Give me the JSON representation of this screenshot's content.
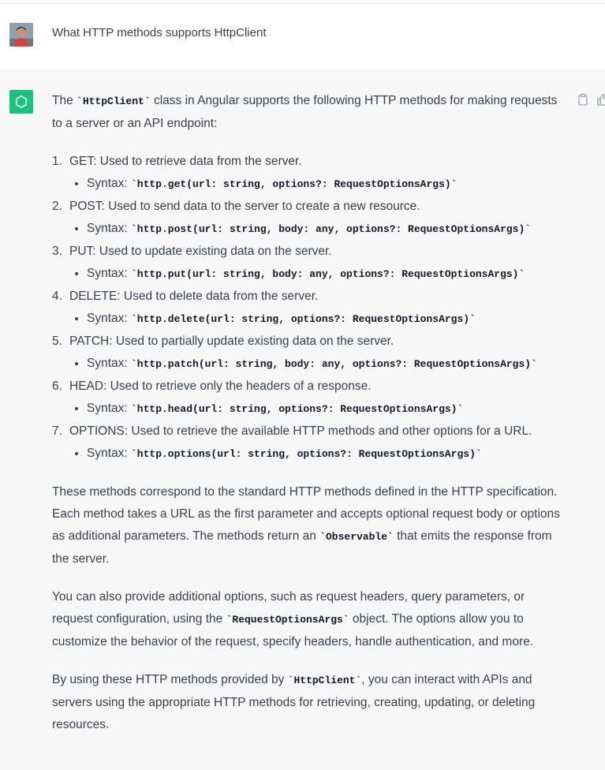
{
  "user": {
    "question": "What HTTP methods supports HttpClient"
  },
  "assistant": {
    "intro": {
      "before": "The ",
      "code": "`HttpClient`",
      "after": " class in Angular supports the following HTTP methods for making requests to a server or an API endpoint:"
    },
    "methods": [
      {
        "number": "1.",
        "text": "GET: Used to retrieve data from the server.",
        "syntax_label": "Syntax: ",
        "syntax": "`http.get(url: string, options?: RequestOptionsArgs)`"
      },
      {
        "number": "2.",
        "text": "POST: Used to send data to the server to create a new resource.",
        "syntax_label": "Syntax: ",
        "syntax": "`http.post(url: string, body: any, options?: RequestOptionsArgs)`"
      },
      {
        "number": "3.",
        "text": "PUT: Used to update existing data on the server.",
        "syntax_label": "Syntax: ",
        "syntax": "`http.put(url: string, body: any, options?: RequestOptionsArgs)`"
      },
      {
        "number": "4.",
        "text": "DELETE: Used to delete data from the server.",
        "syntax_label": "Syntax: ",
        "syntax": "`http.delete(url: string, options?: RequestOptionsArgs)`"
      },
      {
        "number": "5.",
        "text": "PATCH: Used to partially update existing data on the server.",
        "syntax_label": "Syntax: ",
        "syntax": "`http.patch(url: string, body: any, options?: RequestOptionsArgs)`"
      },
      {
        "number": "6.",
        "text": "HEAD: Used to retrieve only the headers of a response.",
        "syntax_label": "Syntax: ",
        "syntax": "`http.head(url: string, options?: RequestOptionsArgs)`"
      },
      {
        "number": "7.",
        "text": "OPTIONS: Used to retrieve the available HTTP methods and other options for a URL.",
        "syntax_label": "Syntax: ",
        "syntax": "`http.options(url: string, options?: RequestOptionsArgs)`"
      }
    ],
    "para1": {
      "before": "These methods correspond to the standard HTTP methods defined in the HTTP specification. Each method takes a URL as the first parameter and accepts optional request body or options as additional parameters. The methods return an ",
      "code": "`Observable`",
      "after": " that emits the response from the server."
    },
    "para2": {
      "before": "You can also provide additional options, such as request headers, query parameters, or request configuration, using the ",
      "code": "`RequestOptionsArgs`",
      "after": " object. The options allow you to customize the behavior of the request, specify headers, handle authentication, and more."
    },
    "para3": {
      "before": "By using these HTTP methods provided by ",
      "code": "`HttpClient`",
      "after": ", you can interact with APIs and servers using the appropriate HTTP methods for retrieving, creating, updating, or deleting resources."
    }
  },
  "icons": {
    "user_avatar": "user-avatar",
    "assistant_logo": "openai-logo-icon",
    "copy": "clipboard-icon",
    "thumbs_up": "thumbs-up-icon"
  },
  "colors": {
    "assistant_bg": "#f7f7f8",
    "logo_bg": "#19c37d",
    "text": "#374151"
  }
}
